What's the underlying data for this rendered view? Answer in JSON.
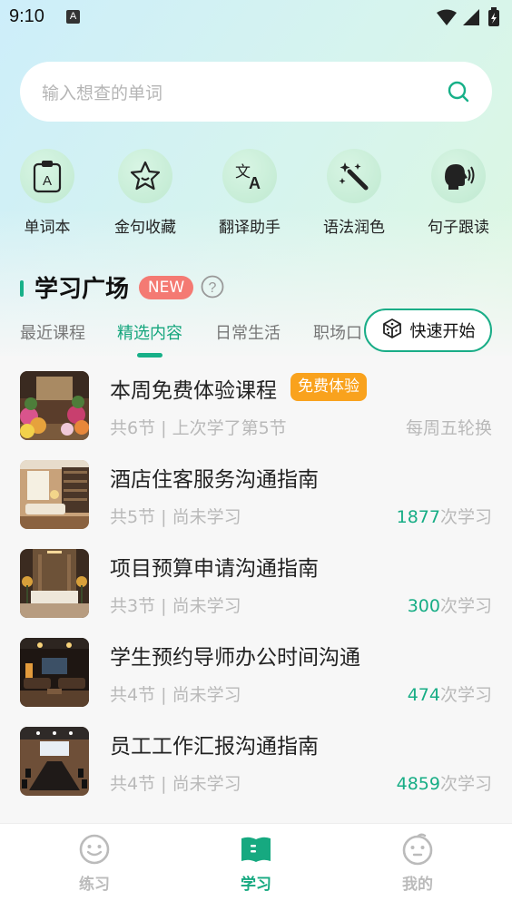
{
  "status_bar": {
    "time": "9:10",
    "notification_letter": "A"
  },
  "search": {
    "placeholder": "输入想查的单词",
    "icon": "search-icon"
  },
  "tools": [
    {
      "label": "单词本",
      "icon": "wordbook-icon"
    },
    {
      "label": "金句收藏",
      "icon": "star-icon"
    },
    {
      "label": "翻译助手",
      "icon": "translate-icon"
    },
    {
      "label": "语法润色",
      "icon": "magic-wand-icon"
    },
    {
      "label": "句子跟读",
      "icon": "speaking-head-icon"
    }
  ],
  "section": {
    "title": "学习广场",
    "badge": "NEW"
  },
  "tabs": [
    {
      "label": "最近课程",
      "active": false
    },
    {
      "label": "精选内容",
      "active": true
    },
    {
      "label": "日常生活",
      "active": false
    },
    {
      "label": "职场口",
      "active": false
    }
  ],
  "quick_start": {
    "label": "快速开始",
    "icon": "dice-icon"
  },
  "courses": [
    {
      "title": "本周免费体验课程",
      "badge": "免费体验",
      "meta": "共6节 | 上次学了第5节",
      "right_text": "每周五轮换",
      "scene": "flower-shop"
    },
    {
      "title": "酒店住客服务沟通指南",
      "meta": "共5节 | 尚未学习",
      "count": "1877",
      "count_suffix": "次学习",
      "scene": "hotel-lounge"
    },
    {
      "title": "项目预算申请沟通指南",
      "meta": "共3节 | 尚未学习",
      "count": "300",
      "count_suffix": "次学习",
      "scene": "reception"
    },
    {
      "title": "学生预约导师办公时间沟通",
      "meta": "共4节 | 尚未学习",
      "count": "474",
      "count_suffix": "次学习",
      "scene": "office-room"
    },
    {
      "title": "员工工作汇报沟通指南",
      "meta": "共4节 | 尚未学习",
      "count": "4859",
      "count_suffix": "次学习",
      "scene": "meeting-room"
    }
  ],
  "bottom_nav": [
    {
      "label": "练习",
      "icon": "smile-face-icon",
      "active": false
    },
    {
      "label": "学习",
      "icon": "open-book-icon",
      "active": true
    },
    {
      "label": "我的",
      "icon": "profile-face-icon",
      "active": false
    }
  ],
  "colors": {
    "accent": "#17b088",
    "badge_new": "#f47a73",
    "badge_free": "#f9a21d"
  }
}
